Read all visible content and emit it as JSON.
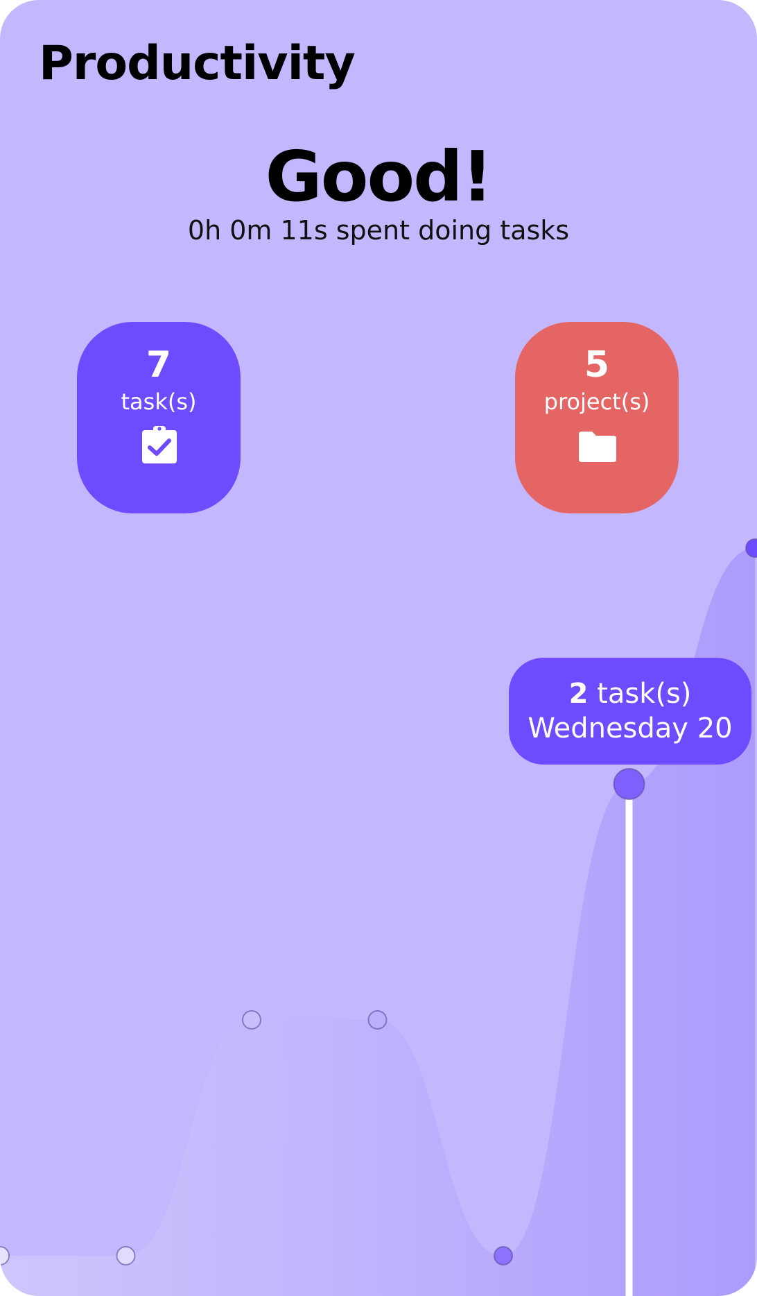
{
  "header": {
    "title": "Productivity"
  },
  "summary": {
    "headline": "Good!",
    "time_spent": "0h 0m 11s spent doing tasks"
  },
  "stats": {
    "tasks": {
      "count": "7",
      "label": "task(s)",
      "icon": "clipboard-check-icon",
      "color": "#6e4bff"
    },
    "projects": {
      "count": "5",
      "label": "project(s)",
      "icon": "folder-icon",
      "color": "#e56565"
    }
  },
  "tooltip": {
    "count": "2",
    "unit": "task(s)",
    "day": "Wednesday 20"
  },
  "colors": {
    "background": "#c3b7fd",
    "accent": "#6e4bff",
    "danger": "#e56565"
  },
  "chart_data": {
    "type": "area",
    "series": [
      {
        "values": [
          0,
          0,
          1,
          1,
          0,
          2,
          3
        ]
      }
    ],
    "selected_index": 5,
    "ylim": [
      0,
      3
    ]
  }
}
